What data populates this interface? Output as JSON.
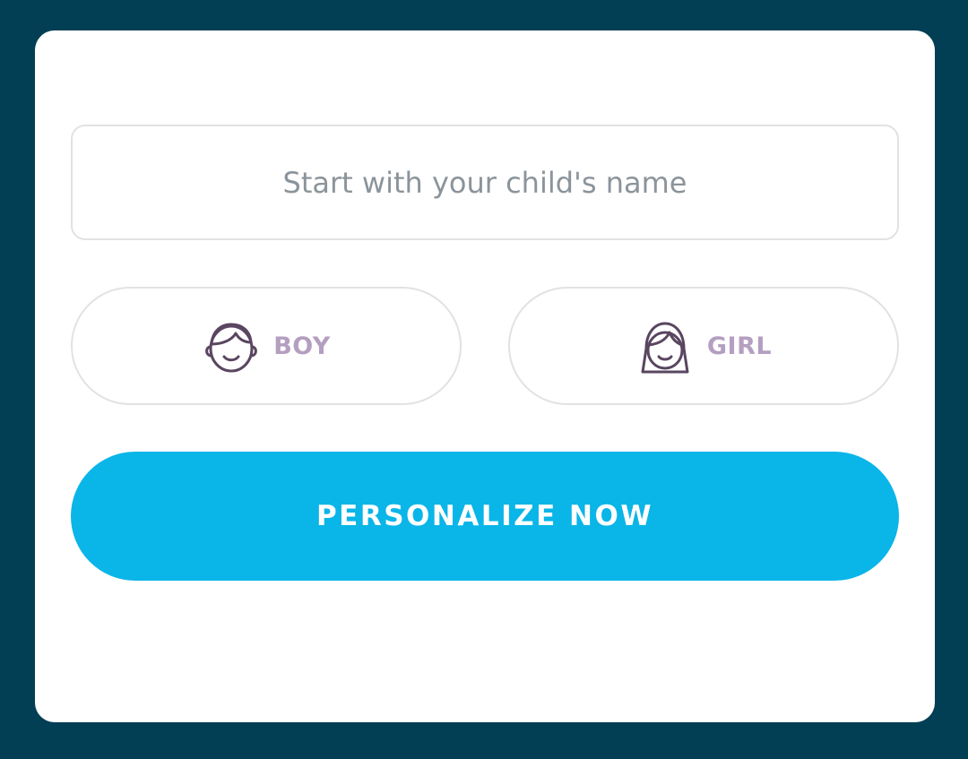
{
  "form": {
    "name_placeholder": "Start with your child's name",
    "name_value": "",
    "gender_options": [
      {
        "label": "BOY",
        "icon": "boy-face-icon"
      },
      {
        "label": "GIRL",
        "icon": "girl-face-icon"
      }
    ],
    "submit_label": "PERSONALIZE NOW"
  },
  "colors": {
    "page_background": "#033f54",
    "card_background": "#ffffff",
    "border": "#e2e2e2",
    "placeholder_text": "#8b949b",
    "gender_label": "#b49fc0",
    "icon_stroke": "#5a4660",
    "cta_background": "#0ab5e8",
    "cta_text": "#ffffff"
  }
}
